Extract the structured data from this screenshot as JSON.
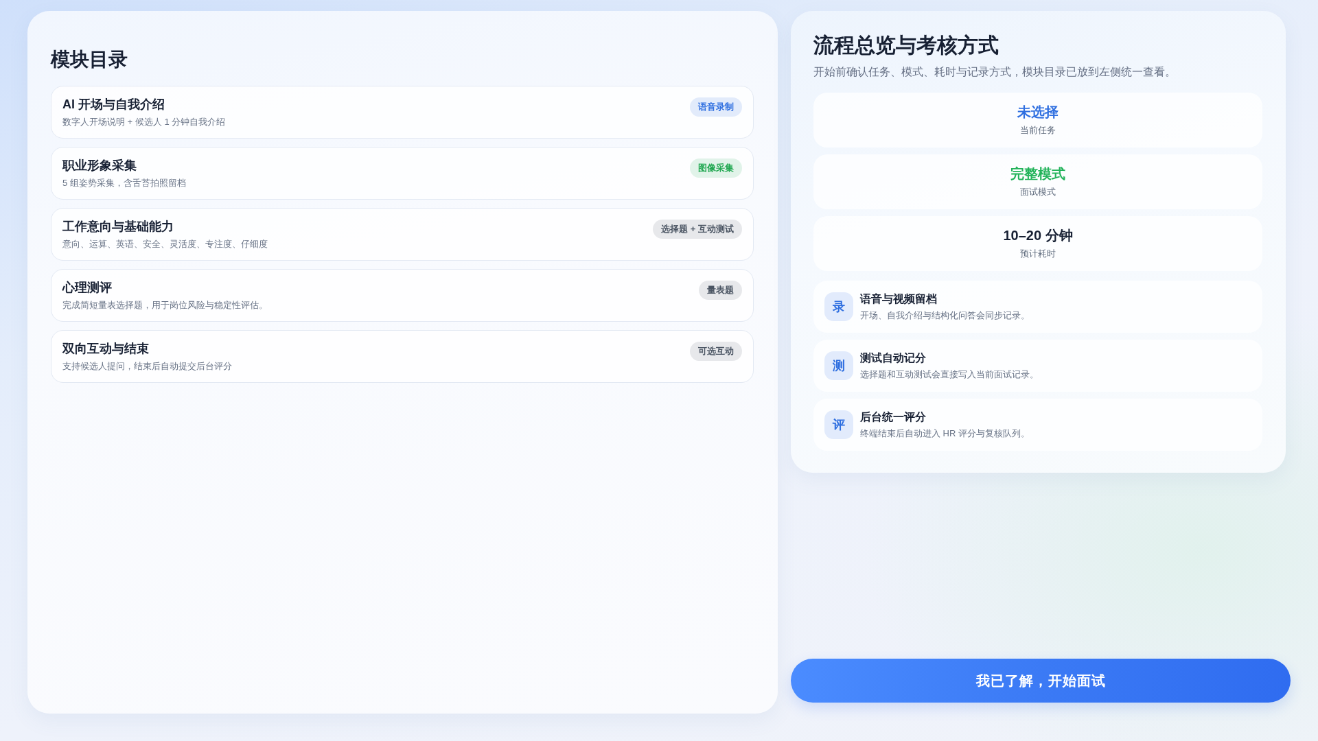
{
  "module_catalog": {
    "title": "模块目录",
    "modules": [
      {
        "title": "AI 开场与自我介绍",
        "description": "数字人开场说明 + 候选人 1 分钟自我介绍",
        "tag": {
          "label": "语音录制",
          "color": "#2f6fe0"
        }
      },
      {
        "title": "职业形象采集",
        "description": "5 组姿势采集，含舌苔拍照留档",
        "tag": {
          "label": "图像采集",
          "color": "#22a852"
        }
      },
      {
        "title": "工作意向与基础能力",
        "description": "意向、运算、英语、安全、灵活度、专注度、仔细度",
        "tag": {
          "label": "选择题 + 互动测试",
          "color": "#4b5563"
        }
      },
      {
        "title": "心理测评",
        "description": "完成简短量表选择题，用于岗位风险与稳定性评估。",
        "tag": {
          "label": "量表题",
          "color": "#4b5563"
        }
      },
      {
        "title": "双向互动与结束",
        "description": "支持候选人提问，结束后自动提交后台评分",
        "tag": {
          "label": "可选互动",
          "color": "#4b5563"
        }
      }
    ]
  },
  "overview": {
    "title": "流程总览与考核方式",
    "subtitle": "开始前确认任务、模式、耗时与记录方式，模块目录已放到左侧统一查看。",
    "stats": [
      {
        "value": "未选择",
        "label": "当前任务",
        "color": "#2f6fe0"
      },
      {
        "value": "完整模式",
        "label": "面试模式",
        "color": "#22b35a"
      },
      {
        "value": "10–20 分钟",
        "label": "预计耗时",
        "color": "#172033"
      }
    ],
    "features": [
      {
        "symbol": "录",
        "title": "语音与视频留档",
        "description": "开场、自我介绍与结构化问答会同步记录。"
      },
      {
        "symbol": "测",
        "title": "测试自动记分",
        "description": "选择题和互动测试会直接写入当前面试记录。"
      },
      {
        "symbol": "评",
        "title": "后台统一评分",
        "description": "终端结束后自动进入 HR 评分与复核队列。"
      }
    ]
  },
  "start_button": {
    "label": "我已了解，开始面试"
  }
}
